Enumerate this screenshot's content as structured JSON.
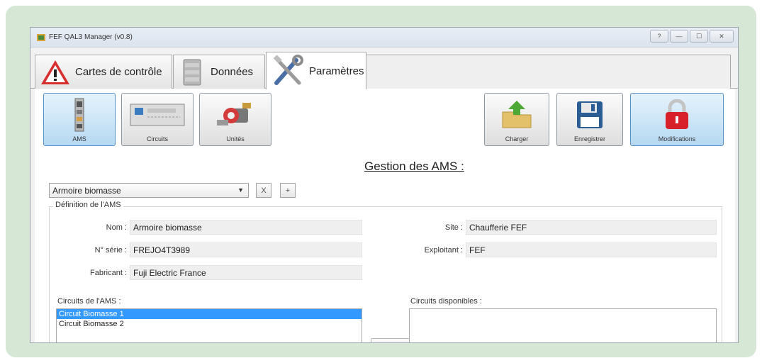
{
  "window": {
    "title": "FEF QAL3 Manager (v0.8)",
    "buttons": {
      "help": "?",
      "minimize": "—",
      "maximize": "☐",
      "close": "✕"
    }
  },
  "tabs": [
    {
      "label": "Cartes de contrôle",
      "icon": "warning-icon",
      "active": false
    },
    {
      "label": "Données",
      "icon": "database-icon",
      "active": false
    },
    {
      "label": "Paramètres",
      "icon": "tools-icon",
      "active": true
    }
  ],
  "toolbar": {
    "left": [
      {
        "label": "AMS",
        "icon": "ams-cabinet-icon",
        "selected": true
      },
      {
        "label": "Circuits",
        "icon": "analyzer-icon",
        "selected": false
      },
      {
        "label": "Unités",
        "icon": "valve-icon",
        "selected": false
      }
    ],
    "right": [
      {
        "label": "Charger",
        "icon": "folder-upload-icon"
      },
      {
        "label": "Enregistrer",
        "icon": "floppy-disk-icon"
      },
      {
        "label": "Modifications",
        "icon": "lock-icon"
      }
    ]
  },
  "section_title": "Gestion des AMS :",
  "selector": {
    "value": "Armoire biomasse",
    "delete_label": "X",
    "add_label": "+"
  },
  "definition": {
    "legend": "Définition de l'AMS",
    "fields": {
      "nom": {
        "label": "Nom :",
        "value": "Armoire biomasse"
      },
      "serie": {
        "label": "N° série :",
        "value": "FREJO4T3989"
      },
      "fabricant": {
        "label": "Fabricant :",
        "value": "Fuji Electric France"
      },
      "site": {
        "label": "Site :",
        "value": "Chaufferie FEF"
      },
      "exploitant": {
        "label": "Exploitant :",
        "value": "FEF"
      }
    }
  },
  "circuits_ams": {
    "label": "Circuits de l'AMS :",
    "items": [
      "Circuit Biomasse 1",
      "Circuit Biomasse 2"
    ],
    "selected_index": 0
  },
  "circuits_disponibles": {
    "label": "Circuits disponibles :",
    "items": []
  },
  "colors": {
    "selection": "#3399ff",
    "frame": "#d6e7d6",
    "selected_button": "#b5d8f2"
  }
}
